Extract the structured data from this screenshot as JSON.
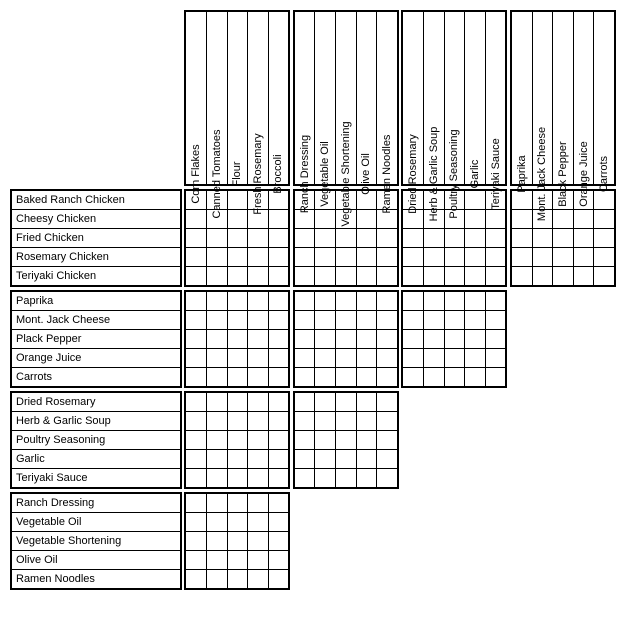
{
  "col_groups": [
    {
      "id": "g1",
      "labels": [
        "Corn Flakes",
        "Canned Tomatoes",
        "Flour",
        "Fresh Rosemary",
        "Broccoli"
      ]
    },
    {
      "id": "g2",
      "labels": [
        "Ranch Dressing",
        "Vegetable Oil",
        "Vegetable Shortening",
        "Olive Oil",
        "Ramen Noodles"
      ]
    },
    {
      "id": "g3",
      "labels": [
        "Dried Rosemary",
        "Herb & Garlic Soup",
        "Poultry Seasoning",
        "Garlic",
        "Teriyaki Sauce"
      ]
    },
    {
      "id": "g4",
      "labels": [
        "Paprika",
        "Mont. Jack Cheese",
        "Black Pepper",
        "Orange Juice",
        "Carrots"
      ]
    }
  ],
  "row_groups": [
    {
      "id": "r1",
      "span": 4,
      "labels": [
        "Baked Ranch Chicken",
        "Cheesy Chicken",
        "Fried Chicken",
        "Rosemary Chicken",
        "Teriyaki Chicken"
      ]
    },
    {
      "id": "r2",
      "span": 3,
      "labels": [
        "Paprika",
        "Mont. Jack Cheese",
        "Plack Pepper",
        "Orange Juice",
        "Carrots"
      ]
    },
    {
      "id": "r3",
      "span": 2,
      "labels": [
        "Dried Rosemary",
        "Herb & Garlic Soup",
        "Poultry Seasoning",
        "Garlic",
        "Teriyaki Sauce"
      ]
    },
    {
      "id": "r4",
      "span": 1,
      "labels": [
        "Ranch Dressing",
        "Vegetable Oil",
        "Vegetable Shortening",
        "Olive Oil",
        "Ramen Noodles"
      ]
    }
  ]
}
